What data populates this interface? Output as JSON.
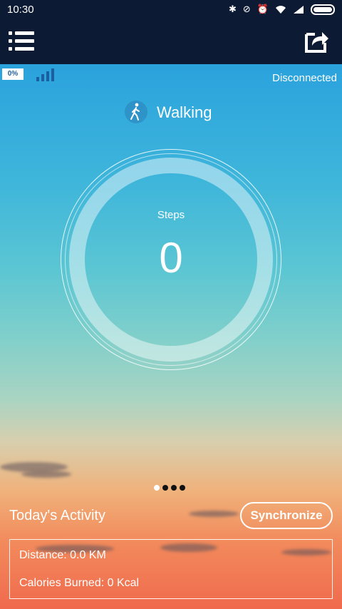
{
  "status_bar": {
    "time": "10:30",
    "icons": [
      "bluetooth-icon",
      "mute-icon",
      "alarm-icon",
      "wifi-icon",
      "signal-icon",
      "battery-icon"
    ]
  },
  "app_bar": {
    "menu_icon": "menu-icon",
    "share_icon": "share-icon"
  },
  "device": {
    "battery_percent": "0%",
    "connection_status": "Disconnected"
  },
  "activity": {
    "mode_icon": "walking-icon",
    "mode_label": "Walking",
    "steps_label": "Steps",
    "steps_value": "0"
  },
  "pager": {
    "count": 4,
    "active_index": 0
  },
  "today": {
    "title": "Today's Activity",
    "sync_label": "Synchronize",
    "distance": "Distance: 0.0 KM",
    "calories": "Calories Burned: 0 Kcal"
  },
  "colors": {
    "header_bg": "#0d1a33",
    "sky_top": "#1f93d8",
    "sky_bottom": "#f06a4d"
  }
}
